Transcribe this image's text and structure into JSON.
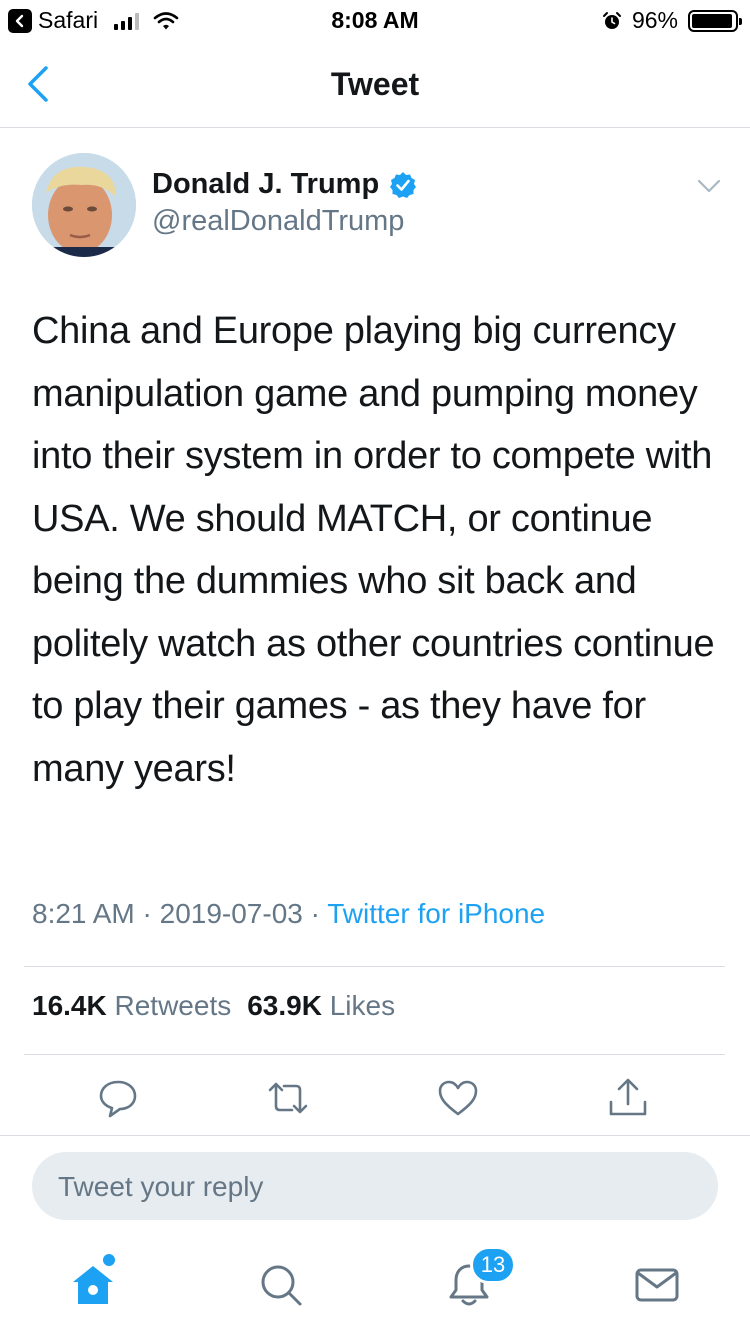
{
  "status_bar": {
    "back_app": "Safari",
    "time": "8:08 AM",
    "battery_percent": "96%",
    "battery_level": 0.96
  },
  "nav": {
    "title": "Tweet"
  },
  "tweet": {
    "author_name": "Donald J. Trump",
    "author_handle": "@realDonaldTrump",
    "text": "China and Europe playing big currency manipulation game and pumping money into their system in order to compete with USA. We should MATCH, or continue being the dummies who sit back and politely watch as other countries continue to play their games - as they have for many years!",
    "time": "8:21 AM",
    "date": "2019-07-03",
    "separator": "·",
    "source": "Twitter for iPhone",
    "retweets_count": "16.4K",
    "retweets_label": "Retweets",
    "likes_count": "63.9K",
    "likes_label": "Likes"
  },
  "reply": {
    "placeholder": "Tweet your reply"
  },
  "tabbar": {
    "notifications_badge": "13"
  },
  "colors": {
    "accent": "#1da1f2",
    "secondary_text": "#657786",
    "divider": "#d9dde1"
  }
}
